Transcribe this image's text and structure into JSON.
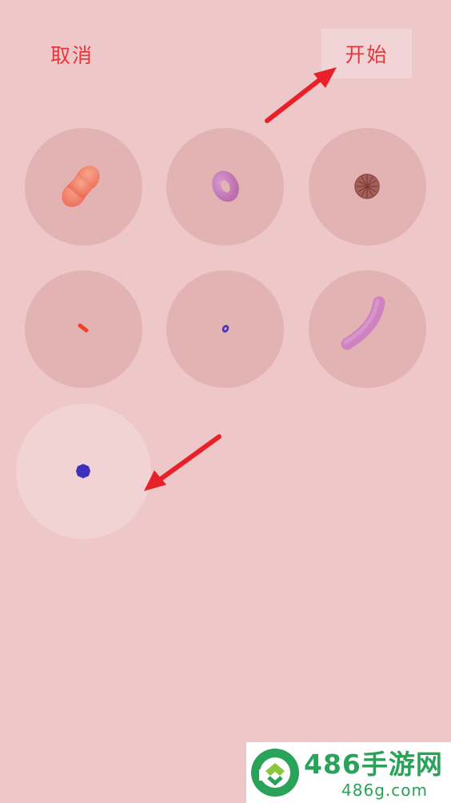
{
  "header": {
    "cancel_label": "取消",
    "start_label": "开始"
  },
  "shapes": [
    {
      "name": "shape-peanut",
      "icon": "peanut-blob-icon",
      "color": "#f07f69",
      "selected": false
    },
    {
      "name": "shape-donut",
      "icon": "donut-ring-icon",
      "color": "#c676b3",
      "selected": false
    },
    {
      "name": "shape-textured-ball",
      "icon": "textured-ball-icon",
      "color": "#a65a56",
      "selected": false
    },
    {
      "name": "shape-small-dash",
      "icon": "small-dash-icon",
      "color": "#f0402e",
      "selected": false
    },
    {
      "name": "shape-tiny-ring",
      "icon": "tiny-ring-icon",
      "color": "#4636b8",
      "selected": false
    },
    {
      "name": "shape-long-capsule",
      "icon": "long-capsule-icon",
      "color": "#cf82c0",
      "selected": false
    },
    {
      "name": "shape-blue-dot",
      "icon": "blue-dot-icon",
      "color": "#3f2fbd",
      "selected": true
    }
  ],
  "watermark": {
    "title": "486手游网",
    "url": "486g.com"
  },
  "colors": {
    "background": "#eec7c8",
    "cell": "#e3b3b4",
    "cell_selected": "#f1d3d3",
    "accent_red": "#e8353b",
    "annotation_arrow": "#e8202a",
    "watermark_green": "#2aa35a"
  }
}
